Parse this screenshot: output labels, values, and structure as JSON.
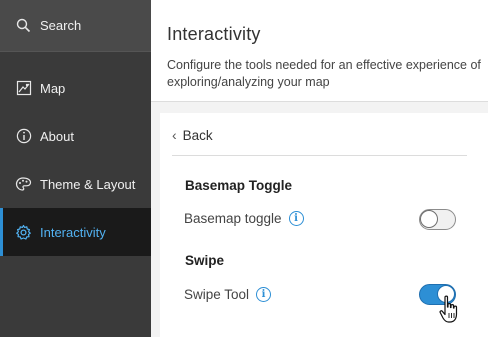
{
  "sidebar": {
    "search_label": "Search",
    "items": [
      {
        "label": "Map",
        "icon": "map-icon"
      },
      {
        "label": "About",
        "icon": "info-icon"
      },
      {
        "label": "Theme & Layout",
        "icon": "palette-icon"
      },
      {
        "label": "Interactivity",
        "icon": "gear-icon"
      }
    ],
    "active_item": "Interactivity"
  },
  "header": {
    "title": "Interactivity",
    "description": "Configure the tools needed for an effective experience of exploring/analyzing your map"
  },
  "panel": {
    "back_label": "Back",
    "sections": [
      {
        "title": "Basemap Toggle",
        "setting_label": "Basemap toggle",
        "enabled": false
      },
      {
        "title": "Swipe",
        "setting_label": "Swipe Tool",
        "enabled": true
      }
    ]
  },
  "colors": {
    "sidebar_bg": "#3a3a3a",
    "active_bg": "#1a1a1a",
    "accent": "#2d8fd5"
  }
}
